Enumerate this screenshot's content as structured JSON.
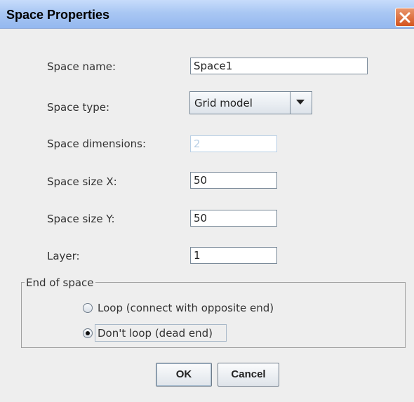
{
  "dialog": {
    "title": "Space Properties",
    "close_icon": "close-icon"
  },
  "form": {
    "space_name": {
      "label": "Space name:",
      "value": "Space1"
    },
    "space_type": {
      "label": "Space type:",
      "value": "Grid model",
      "icon": "chevron-down-icon"
    },
    "space_dimensions": {
      "label": "Space dimensions:",
      "value": "2"
    },
    "space_size_x": {
      "label": "Space size  X:",
      "value": "50"
    },
    "space_size_y": {
      "label": "Space size  Y:",
      "value": "50"
    },
    "layer": {
      "label": "Layer:",
      "value": "1"
    }
  },
  "end_of_space": {
    "title": "End of space",
    "options": [
      {
        "label": "Loop (connect with opposite end)",
        "selected": false
      },
      {
        "label": "Don't loop (dead end)",
        "selected": true
      }
    ]
  },
  "buttons": {
    "ok": "OK",
    "cancel": "Cancel"
  },
  "colors": {
    "title_bar": "#a9c7f3",
    "close_button": "#d4551f",
    "background": "#eeeeee"
  }
}
